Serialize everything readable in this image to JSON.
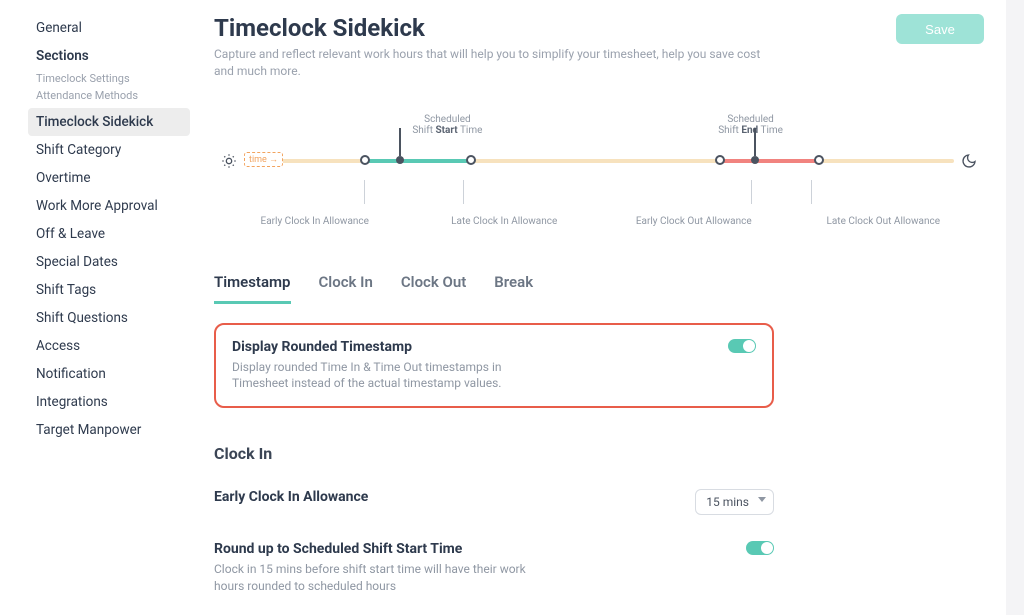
{
  "sidebar": {
    "general": "General",
    "sections_header": "Sections",
    "subs": [
      "Timeclock Settings",
      "Attendance Methods"
    ],
    "items": [
      "Timeclock Sidekick",
      "Shift Category",
      "Overtime",
      "Work More Approval",
      "Off & Leave",
      "Special Dates",
      "Shift Tags",
      "Shift Questions",
      "Access",
      "Notification",
      "Integrations",
      "Target Manpower"
    ]
  },
  "header": {
    "title": "Timeclock Sidekick",
    "subtitle": "Capture and reflect relevant work hours that will help you to simplify your timesheet, help you save cost and much more.",
    "save": "Save"
  },
  "timeline": {
    "time_chip": "time →",
    "top": {
      "start_a": "Scheduled",
      "start_b_pre": "Shift ",
      "start_b_bold": "Start",
      "start_b_post": " Time",
      "end_a": "Scheduled",
      "end_b_pre": "Shift ",
      "end_b_bold": "End",
      "end_b_post": " Time"
    },
    "bottom": {
      "l1": "Early Clock In Allowance",
      "l2": "Late Clock In Allowance",
      "l3": "Early Clock Out Allowance",
      "l4": "Late Clock Out Allowance"
    }
  },
  "tabs": [
    "Timestamp",
    "Clock In",
    "Clock Out",
    "Break"
  ],
  "card": {
    "title": "Display Rounded Timestamp",
    "desc": "Display rounded Time In & Time Out timestamps in Timesheet instead of the actual timestamp values."
  },
  "clockin": {
    "section": "Clock In",
    "early_label": "Early Clock In Allowance",
    "early_value": "15 mins",
    "round_label": "Round up to Scheduled Shift Start Time",
    "round_desc": "Clock in 15 mins before shift start time will have their work hours rounded to scheduled hours"
  }
}
